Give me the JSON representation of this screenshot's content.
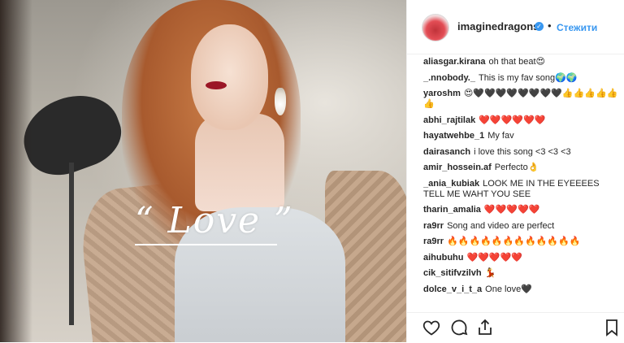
{
  "post": {
    "overlay_text": "“ Love ”"
  },
  "header": {
    "username": "imaginedragons",
    "verified_mark": "✓",
    "separator": "•",
    "follow_label": "Стежити"
  },
  "comments": [
    {
      "user": "aliasgar.kirana",
      "text": "oh that beat😍"
    },
    {
      "user": "_.nnobody._",
      "text": "This is my fav song🌍🌍"
    },
    {
      "user": "yaroshm",
      "text": "😍🖤🖤🖤🖤🖤🖤🖤🖤👍👍👍👍👍👍"
    },
    {
      "user": "abhi_rajtilak",
      "text": "❤️❤️❤️❤️❤️❤️"
    },
    {
      "user": "hayatwehbe_1",
      "text": "My fav"
    },
    {
      "user": "dairasanch",
      "text": "i love this song <3 <3 <3"
    },
    {
      "user": "amir_hossein.af",
      "text": "Perfecto👌"
    },
    {
      "user": "_ania_kubiak",
      "text": "LOOK ME IN THE EYEEEES TELL ME WAHT YOU SEE"
    },
    {
      "user": "tharin_amalia",
      "text": "❤️❤️❤️❤️❤️"
    },
    {
      "user": "ra9rr",
      "text": "Song and video are perfect"
    },
    {
      "user": "ra9rr",
      "text": "🔥🔥🔥🔥🔥🔥🔥🔥🔥🔥🔥🔥"
    },
    {
      "user": "aihubuhu",
      "text": "❤️❤️❤️❤️❤️"
    },
    {
      "user": "cik_sitifvzilvh",
      "text": "💃"
    },
    {
      "user": "dolce_v_i_t_a",
      "text": "One love🖤"
    }
  ],
  "actions": {
    "like_icon": "heart-icon",
    "comment_icon": "comment-icon",
    "share_icon": "share-icon",
    "save_icon": "bookmark-icon"
  }
}
